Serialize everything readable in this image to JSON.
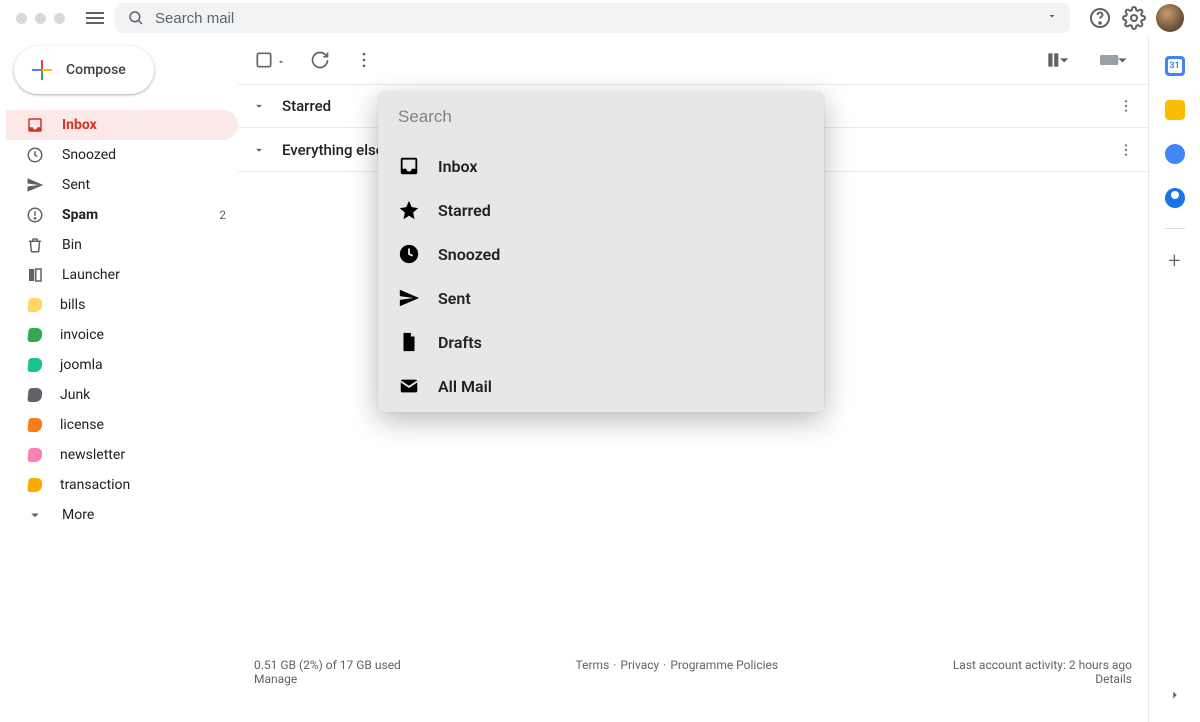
{
  "search_placeholder": "Search mail",
  "compose_label": "Compose",
  "nav": [
    {
      "icon": "inbox",
      "label": "Inbox",
      "active": true
    },
    {
      "icon": "snooze",
      "label": "Snoozed"
    },
    {
      "icon": "sent",
      "label": "Sent"
    },
    {
      "icon": "spam",
      "label": "Spam",
      "bold": true,
      "count": "2"
    },
    {
      "icon": "bin",
      "label": "Bin"
    },
    {
      "icon": "launcher",
      "label": "Launcher"
    }
  ],
  "labels": [
    {
      "color": "#fdd663",
      "label": "bills"
    },
    {
      "color": "#34a853",
      "label": "invoice"
    },
    {
      "color": "#1ec28b",
      "label": "joomla"
    },
    {
      "color": "#5f6368",
      "label": "Junk"
    },
    {
      "color": "#fa7b17",
      "label": "license"
    },
    {
      "color": "#f882b4",
      "label": "newsletter"
    },
    {
      "color": "#f9ab00",
      "label": "transaction"
    }
  ],
  "more_label": "More",
  "sections": [
    {
      "label": "Starred"
    },
    {
      "label": "Everything else"
    }
  ],
  "popup": {
    "search_placeholder": "Search",
    "items": [
      {
        "icon": "inbox",
        "label": "Inbox"
      },
      {
        "icon": "star",
        "label": "Starred"
      },
      {
        "icon": "clock",
        "label": "Snoozed"
      },
      {
        "icon": "sent",
        "label": "Sent"
      },
      {
        "icon": "draft",
        "label": "Drafts"
      },
      {
        "icon": "mail",
        "label": "All Mail"
      }
    ]
  },
  "footer": {
    "storage_line": "0.51 GB (2%) of 17 GB used",
    "manage": "Manage",
    "terms": "Terms",
    "privacy": "Privacy",
    "policies": "Programme Policies",
    "activity": "Last account activity: 2 hours ago",
    "details": "Details"
  }
}
